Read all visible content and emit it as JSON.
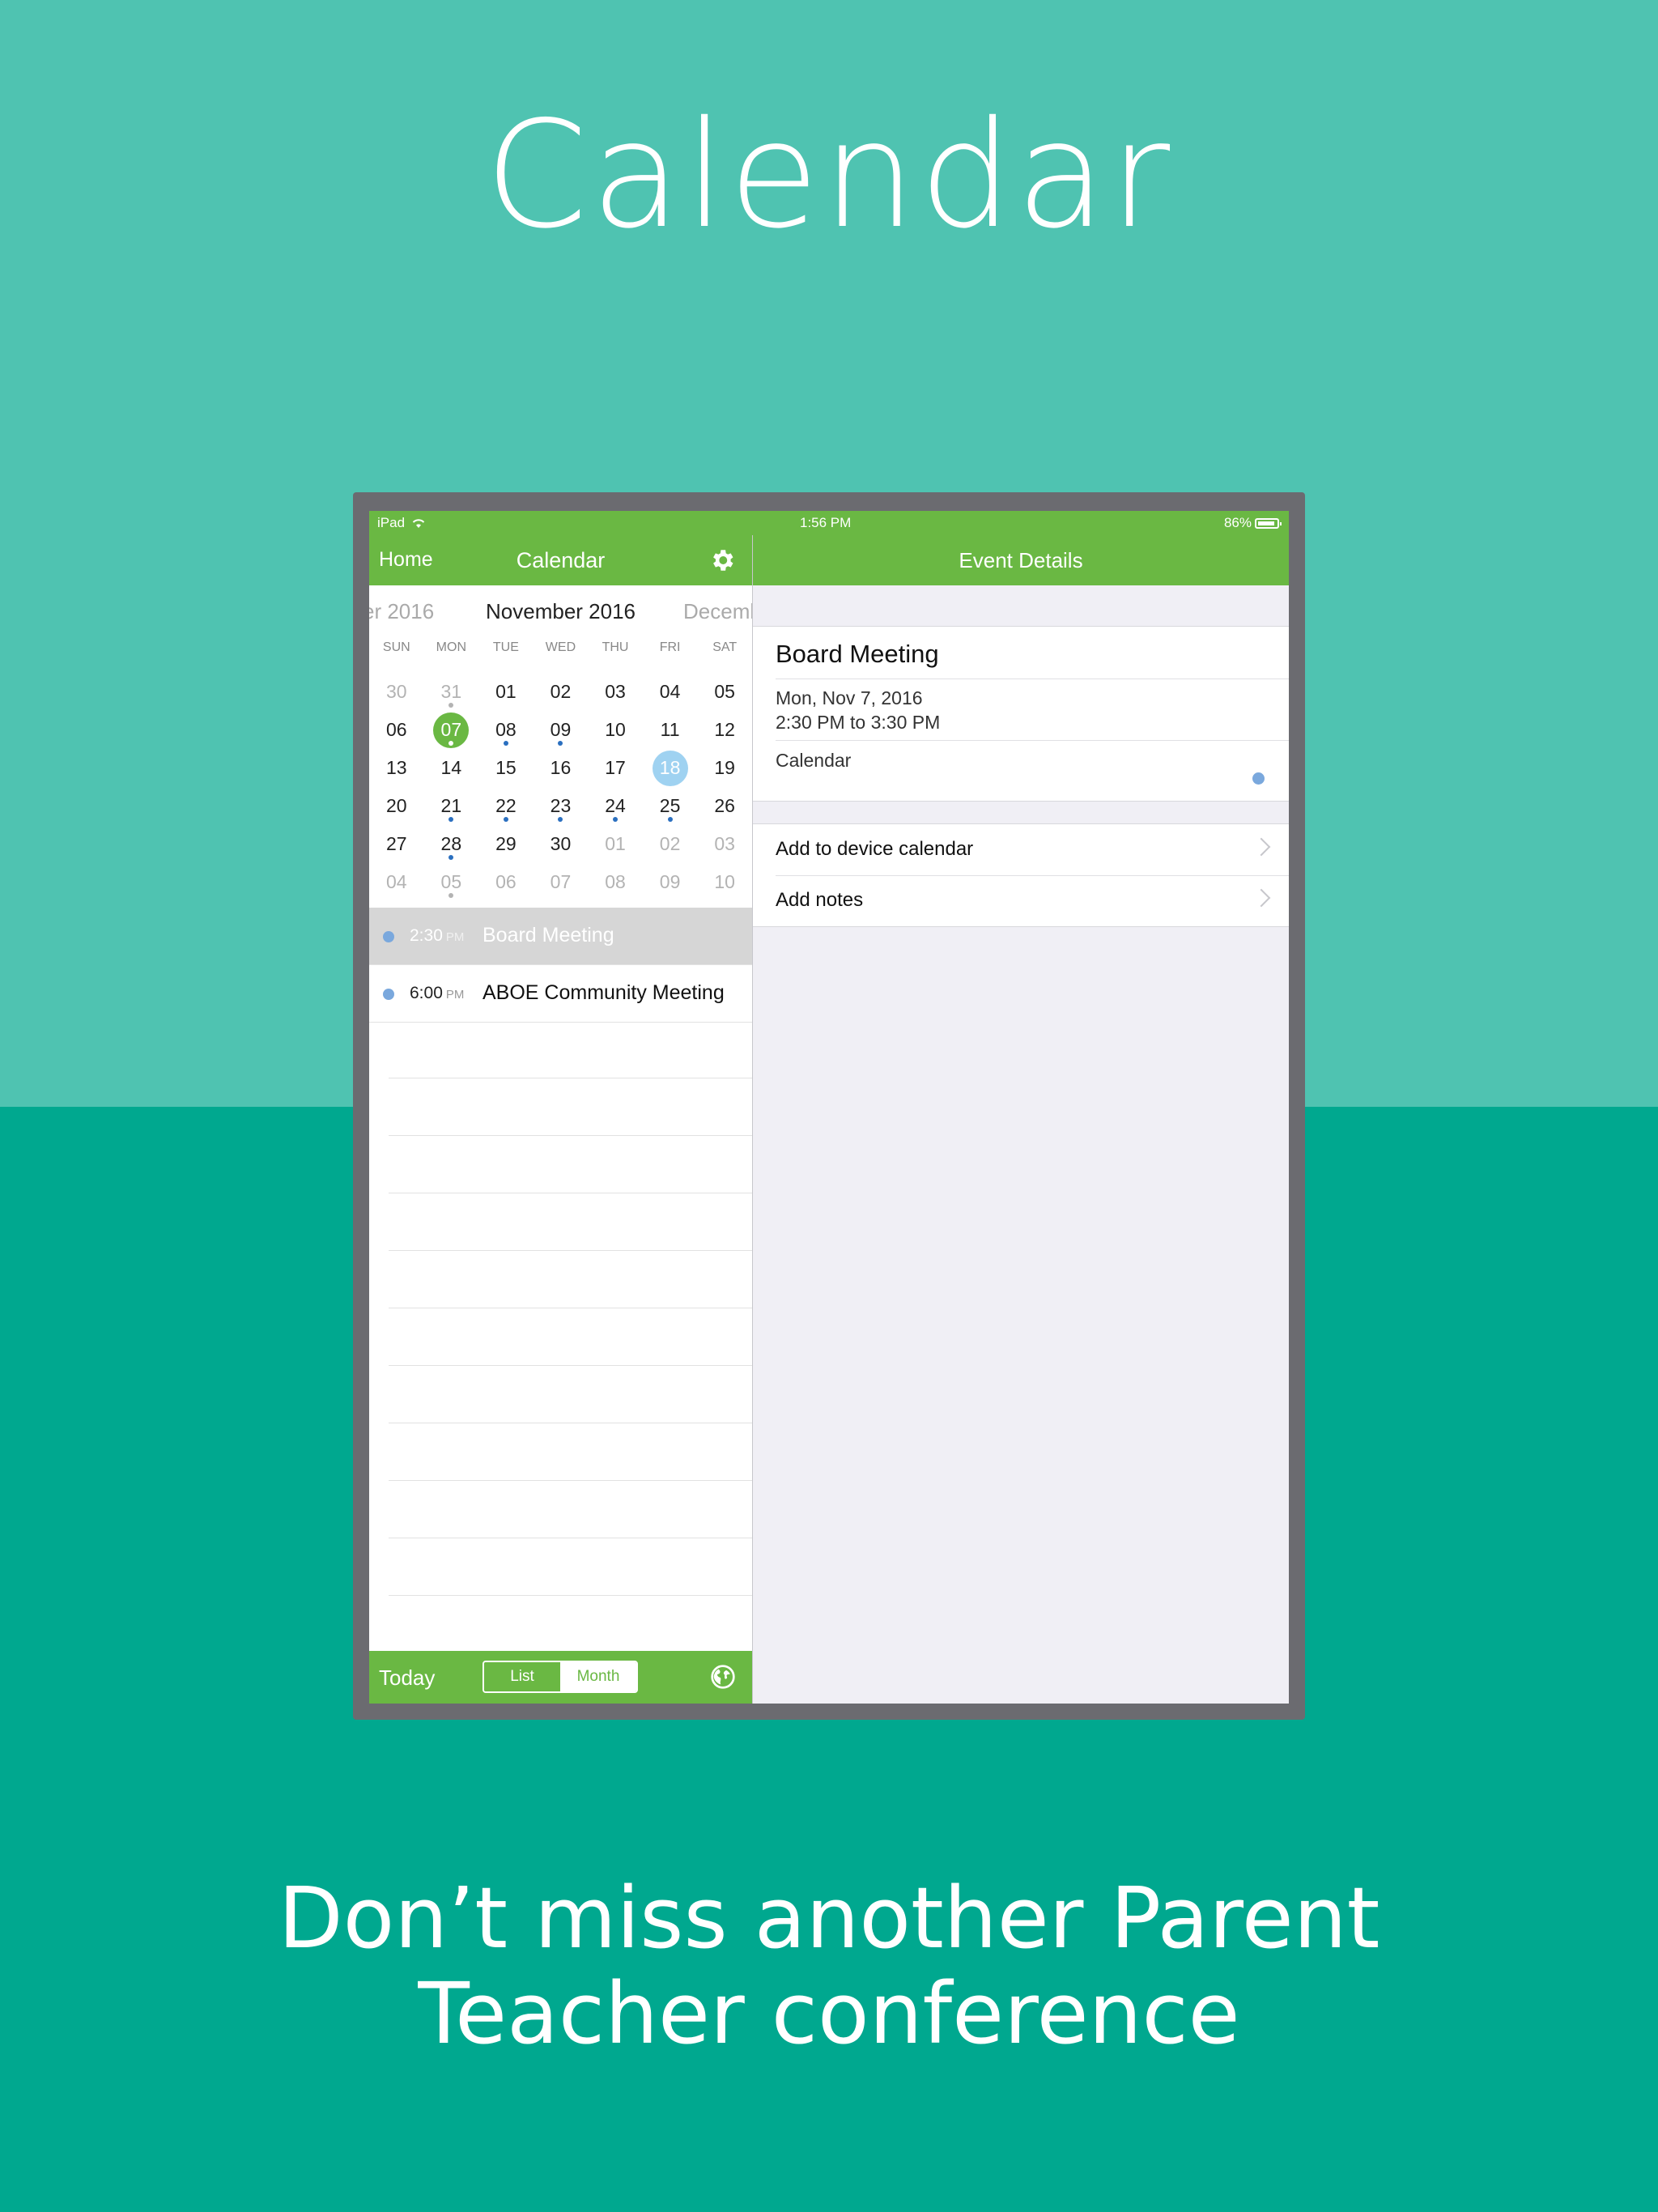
{
  "hero": {
    "title": "Calendar",
    "tagline_line1": "Don’t miss another Parent",
    "tagline_line2": "Teacher conference"
  },
  "statusbar": {
    "device": "iPad",
    "time": "1:56 PM",
    "battery": "86%"
  },
  "left_nav": {
    "back_label": "Home",
    "title": "Calendar",
    "settings_icon": "gear-icon"
  },
  "month_strip": {
    "prev": "er 2016",
    "current": "November 2016",
    "next": "Decemb"
  },
  "weekdays": [
    "SUN",
    "MON",
    "TUE",
    "WED",
    "THU",
    "FRI",
    "SAT"
  ],
  "calendar": {
    "weeks": [
      [
        {
          "d": "30",
          "o": true
        },
        {
          "d": "31",
          "o": true,
          "dot": true
        },
        {
          "d": "01"
        },
        {
          "d": "02"
        },
        {
          "d": "03"
        },
        {
          "d": "04"
        },
        {
          "d": "05"
        }
      ],
      [
        {
          "d": "06"
        },
        {
          "d": "07",
          "sel": true,
          "dot": true
        },
        {
          "d": "08",
          "dot": true
        },
        {
          "d": "09",
          "dot": true
        },
        {
          "d": "10"
        },
        {
          "d": "11"
        },
        {
          "d": "12"
        }
      ],
      [
        {
          "d": "13"
        },
        {
          "d": "14"
        },
        {
          "d": "15"
        },
        {
          "d": "16"
        },
        {
          "d": "17"
        },
        {
          "d": "18",
          "today": true
        },
        {
          "d": "19"
        }
      ],
      [
        {
          "d": "20"
        },
        {
          "d": "21",
          "dot": true
        },
        {
          "d": "22",
          "dot": true
        },
        {
          "d": "23",
          "dot": true
        },
        {
          "d": "24",
          "dot": true
        },
        {
          "d": "25",
          "dot": true
        },
        {
          "d": "26"
        }
      ],
      [
        {
          "d": "27"
        },
        {
          "d": "28",
          "dot": true
        },
        {
          "d": "29"
        },
        {
          "d": "30"
        },
        {
          "d": "01",
          "o": true
        },
        {
          "d": "02",
          "o": true
        },
        {
          "d": "03",
          "o": true
        }
      ],
      [
        {
          "d": "04",
          "o": true
        },
        {
          "d": "05",
          "o": true,
          "dot": true
        },
        {
          "d": "06",
          "o": true
        },
        {
          "d": "07",
          "o": true
        },
        {
          "d": "08",
          "o": true
        },
        {
          "d": "09",
          "o": true
        },
        {
          "d": "10",
          "o": true
        }
      ]
    ]
  },
  "events": [
    {
      "time": "2:30",
      "ampm": "PM",
      "title": "Board Meeting",
      "selected": true
    },
    {
      "time": "6:00",
      "ampm": "PM",
      "title": "ABOE Community Meeting",
      "selected": false
    }
  ],
  "toolbar": {
    "today_label": "Today",
    "list_label": "List",
    "month_label": "Month",
    "globe_icon": "globe-icon"
  },
  "right_nav": {
    "title": "Event Details"
  },
  "detail": {
    "title": "Board Meeting",
    "date": "Mon, Nov 7, 2016",
    "time": "2:30 PM to 3:30 PM",
    "calendar_label": "Calendar"
  },
  "actions": {
    "add_device": "Add to device calendar",
    "add_notes": "Add notes"
  },
  "colors": {
    "brand_green": "#6ab843",
    "teal_top": "#4fc3b1",
    "teal_bottom": "#00a88f",
    "event_dot": "#7aa8dd",
    "today_circle": "#9fd2f1"
  }
}
